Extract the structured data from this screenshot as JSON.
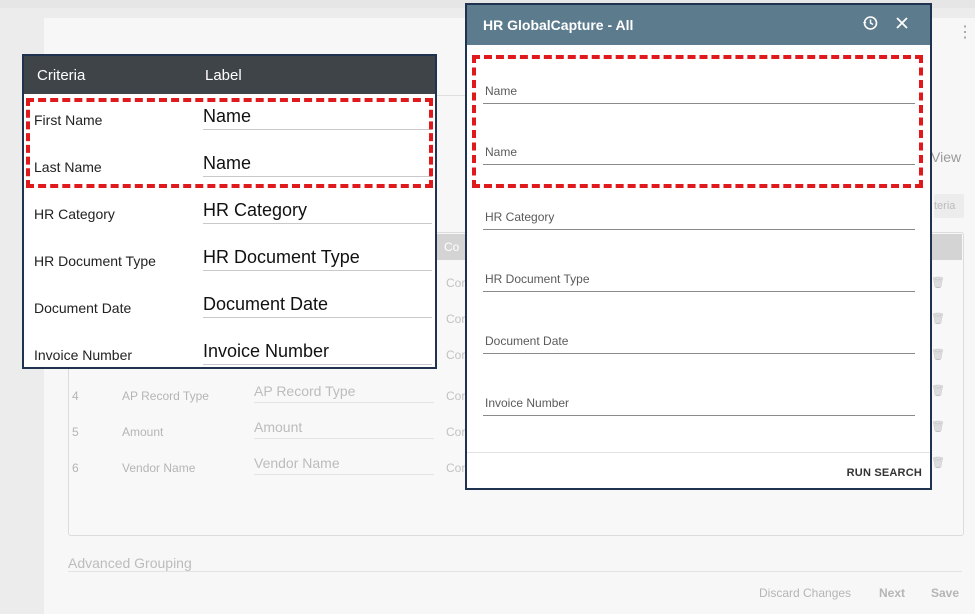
{
  "background": {
    "view_label": "View",
    "criteria_button": "teria",
    "table_head_fragment": "Co",
    "rows": [
      {
        "num": "4",
        "criteria": "AP Record Type",
        "label": "AP Record Type",
        "con": "Cor"
      },
      {
        "num": "5",
        "criteria": "Amount",
        "label": "Amount",
        "con": "Cor"
      },
      {
        "num": "6",
        "criteria": "Vendor Name",
        "label": "Vendor Name",
        "con": "Cor"
      }
    ],
    "upper_con": [
      "Cor",
      "Cor",
      "Cor"
    ],
    "advanced_grouping": "Advanced Grouping",
    "footer": {
      "discard": "Discard Changes",
      "next": "Next",
      "save": "Save"
    }
  },
  "criteria_panel": {
    "header": {
      "criteria": "Criteria",
      "label": "Label"
    },
    "rows": [
      {
        "criteria": "First Name",
        "label": "Name"
      },
      {
        "criteria": "Last Name",
        "label": "Name"
      },
      {
        "criteria": "HR Category",
        "label": "HR Category"
      },
      {
        "criteria": "HR Document Type",
        "label": "HR Document Type"
      },
      {
        "criteria": "Document Date",
        "label": "Document Date"
      },
      {
        "criteria": "Invoice Number",
        "label": "Invoice Number"
      }
    ],
    "highlight_color": "#e0191c"
  },
  "dialog": {
    "title": "HR GlobalCapture - All",
    "icons": [
      "history-icon",
      "close-icon"
    ],
    "fields": [
      "Name",
      "Name",
      "HR Category",
      "HR Document Type",
      "Document Date",
      "Invoice Number"
    ],
    "run_search": "RUN SEARCH",
    "header_color": "#5c7b8c"
  }
}
